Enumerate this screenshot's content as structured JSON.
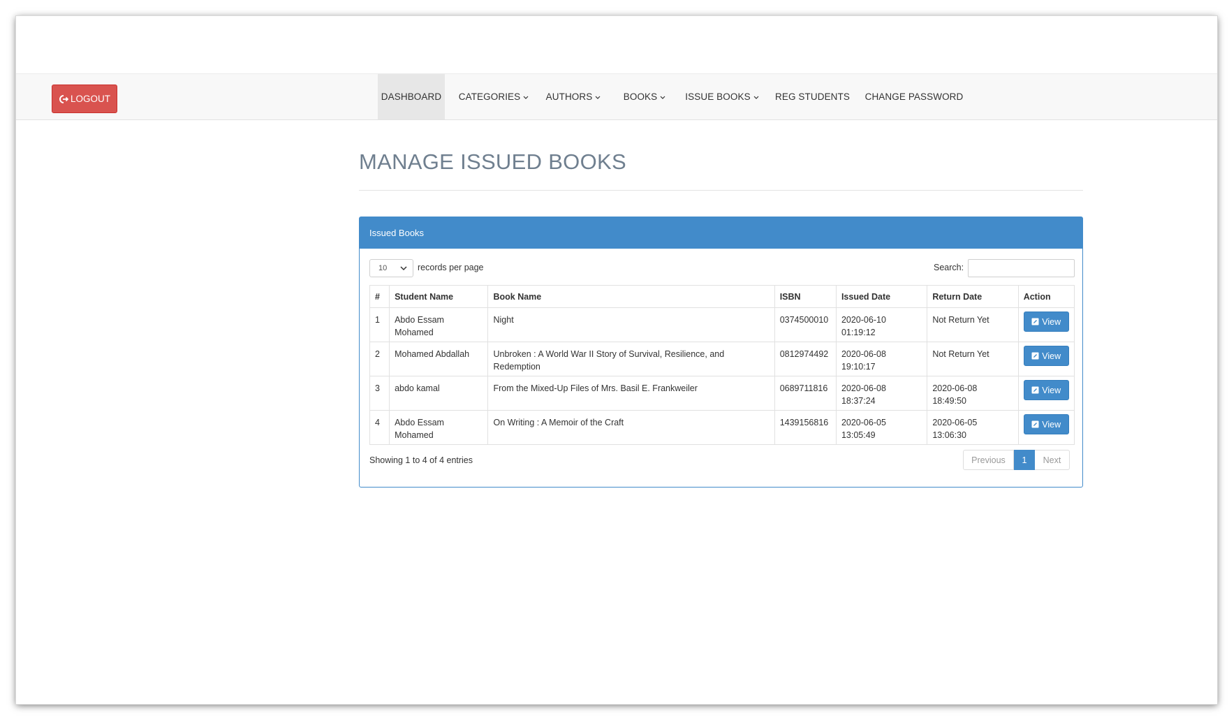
{
  "navbar": {
    "logout_label": "LOGOUT",
    "items": [
      {
        "label": "DASHBOARD",
        "dropdown": false,
        "active": true
      },
      {
        "label": "CATEGORIES",
        "dropdown": true
      },
      {
        "label": "AUTHORS",
        "dropdown": true
      },
      {
        "label": "BOOKS",
        "dropdown": true
      },
      {
        "label": "ISSUE BOOKS",
        "dropdown": true
      },
      {
        "label": "REG STUDENTS",
        "dropdown": false
      },
      {
        "label": "CHANGE PASSWORD",
        "dropdown": false
      }
    ]
  },
  "page": {
    "title": "MANAGE ISSUED BOOKS"
  },
  "panel": {
    "heading": "Issued Books",
    "length_value": "10",
    "length_label": "records per page",
    "search_label": "Search:",
    "search_value": "",
    "columns": [
      "#",
      "Student Name",
      "Book Name",
      "ISBN",
      "Issued Date",
      "Return Date",
      "Action"
    ],
    "rows": [
      {
        "num": "1",
        "student": "Abdo Essam Mohamed",
        "book": "Night",
        "isbn": "0374500010",
        "issued": "2020-06-10 01:19:12",
        "returned": "Not Return Yet",
        "action": "View"
      },
      {
        "num": "2",
        "student": "Mohamed Abdallah",
        "book": "Unbroken : A World War II Story of Survival, Resilience, and Redemption",
        "isbn": "0812974492",
        "issued": "2020-06-08 19:10:17",
        "returned": "Not Return Yet",
        "action": "View"
      },
      {
        "num": "3",
        "student": "abdo kamal",
        "book": "From the Mixed-Up Files of Mrs. Basil E. Frankweiler",
        "isbn": "0689711816",
        "issued": "2020-06-08 18:37:24",
        "returned": "2020-06-08 18:49:50",
        "action": "View"
      },
      {
        "num": "4",
        "student": "Abdo Essam Mohamed",
        "book": "On Writing : A Memoir of the Craft",
        "isbn": "1439156816",
        "issued": "2020-06-05 13:05:49",
        "returned": "2020-06-05 13:06:30",
        "action": "View"
      }
    ],
    "info": "Showing 1 to 4 of 4 entries",
    "pagination": {
      "previous": "Previous",
      "current": "1",
      "next": "Next"
    }
  },
  "colors": {
    "primary": "#428bca",
    "danger": "#d9534f",
    "title": "#6f7f8f"
  }
}
